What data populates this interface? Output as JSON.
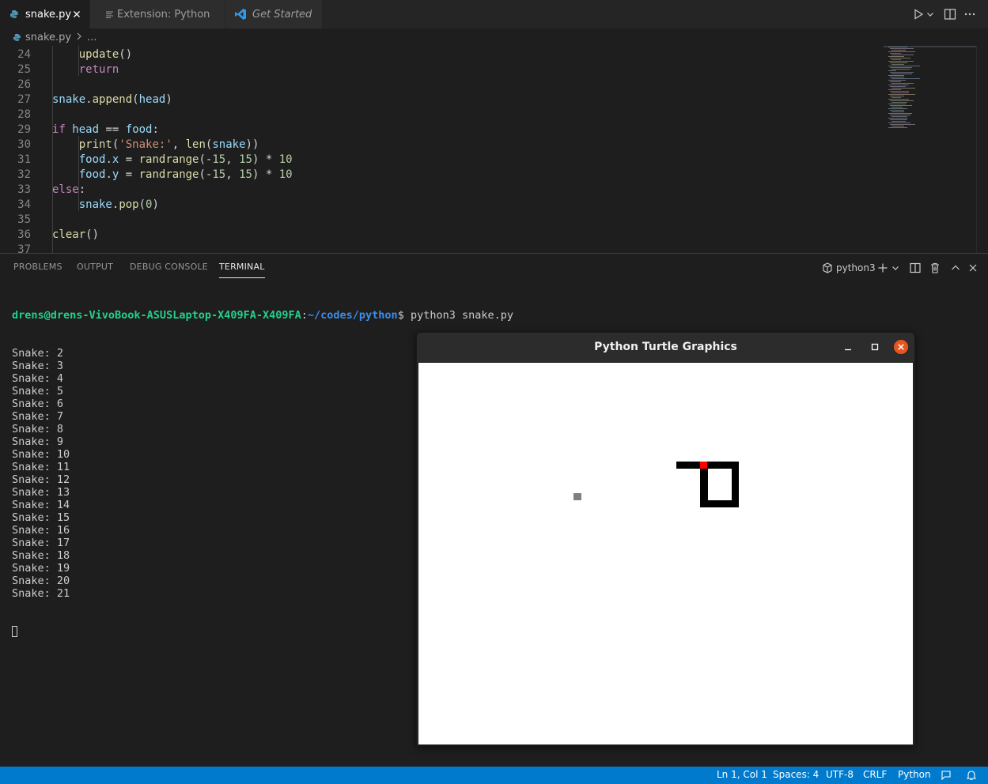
{
  "tabs": [
    {
      "label": "snake.py",
      "active": true,
      "icon": "python-file-icon"
    },
    {
      "label": "Extension: Python",
      "active": false,
      "icon": "extension-doc-icon"
    },
    {
      "label": "Get Started",
      "active": false,
      "icon": "vscode-logo-icon"
    }
  ],
  "breadcrumb": {
    "file": "snake.py",
    "more": "..."
  },
  "editor": {
    "lines": [
      {
        "n": "24",
        "text": "        update()"
      },
      {
        "n": "25",
        "text": "        return"
      },
      {
        "n": "26",
        "text": ""
      },
      {
        "n": "27",
        "text": "    snake.append(head)"
      },
      {
        "n": "28",
        "text": ""
      },
      {
        "n": "29",
        "text": "    if head == food:"
      },
      {
        "n": "30",
        "text": "        print('Snake:', len(snake))"
      },
      {
        "n": "31",
        "text": "        food.x = randrange(-15, 15) * 10"
      },
      {
        "n": "32",
        "text": "        food.y = randrange(-15, 15) * 10"
      },
      {
        "n": "33",
        "text": "    else:"
      },
      {
        "n": "34",
        "text": "        snake.pop(0)"
      },
      {
        "n": "35",
        "text": ""
      },
      {
        "n": "36",
        "text": "    clear()"
      },
      {
        "n": "37",
        "text": ""
      }
    ]
  },
  "panel": {
    "tabs": [
      "PROBLEMS",
      "OUTPUT",
      "DEBUG CONSOLE",
      "TERMINAL"
    ],
    "active_tab": "TERMINAL",
    "terminal_name": "python3"
  },
  "terminal": {
    "prompt_user": "drens@drens-VivoBook-ASUSLaptop-X409FA-X409FA",
    "prompt_sep": ":",
    "prompt_path": "~/codes/python",
    "prompt_dollar": "$ ",
    "command": "python3 snake.py",
    "output": [
      "Snake: 2",
      "Snake: 3",
      "Snake: 4",
      "Snake: 5",
      "Snake: 6",
      "Snake: 7",
      "Snake: 8",
      "Snake: 9",
      "Snake: 10",
      "Snake: 11",
      "Snake: 12",
      "Snake: 13",
      "Snake: 14",
      "Snake: 15",
      "Snake: 16",
      "Snake: 17",
      "Snake: 18",
      "Snake: 19",
      "Snake: 20",
      "Snake: 21"
    ]
  },
  "turtle_window": {
    "title": "Python Turtle Graphics"
  },
  "statusbar": {
    "position": "Ln 1, Col 1",
    "spaces": "Spaces: 4",
    "encoding": "UTF-8",
    "eol": "CRLF",
    "language": "Python"
  },
  "colors": {
    "accent": "#007acc",
    "snake": "#000000",
    "snake_head": "#ff0000",
    "food": "#808080"
  }
}
